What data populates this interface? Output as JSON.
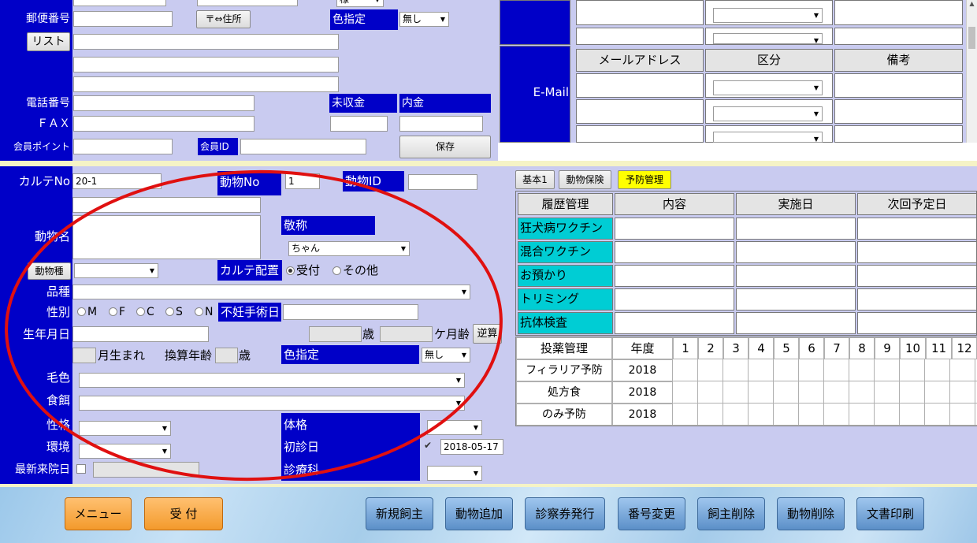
{
  "owner": {
    "postal_label": "郵便番号",
    "postal_btn": "〒⇔住所",
    "color_label": "色指定",
    "color_value": "無し",
    "list_btn": "リスト",
    "phone_label": "電話番号",
    "fax_label": "ＦＡＸ",
    "points_label": "会員ポイント",
    "member_id_label": "会員ID",
    "unpaid_label": "未収金",
    "deposit_label": "内金",
    "save_btn": "保存",
    "honorific_top": "様"
  },
  "email": {
    "label": "E-Mail",
    "headers": [
      "メールアドレス",
      "区分",
      "備考"
    ]
  },
  "animal": {
    "karte_no_label": "カルテNo",
    "karte_no_value": "20-1",
    "animal_no_label": "動物No",
    "animal_no_value": "1",
    "animal_id_label": "動物ID",
    "name_label": "動物名",
    "honorific_label": "敬称",
    "honorific_value": "ちゃん",
    "species_btn": "動物種",
    "karte_place_label": "カルテ配置",
    "radio_reception": "受付",
    "radio_other": "その他",
    "breed_label": "品種",
    "sex_label": "性別",
    "sex_options": [
      "M",
      "F",
      "C",
      "S",
      "N"
    ],
    "neuter_label": "不妊手術日",
    "birth_label": "生年月日",
    "age_unit": "歳",
    "month_unit": "ケ月齢",
    "reverse_btn": "逆算",
    "born_month": "月生まれ",
    "converted_age": "換算年齢",
    "converted_unit": "歳",
    "color_label": "色指定",
    "color_value": "無し",
    "coat_label": "毛色",
    "food_label": "食餌",
    "temper_label": "性格",
    "env_label": "環境",
    "last_visit_label": "最新来院日",
    "build_label": "体格",
    "first_visit_label": "初診日",
    "first_visit_value": "2018-05-17",
    "dept_label": "診療科"
  },
  "tabs": [
    "基本1",
    "動物保険",
    "予防管理"
  ],
  "prevention": {
    "headers": [
      "履歴管理",
      "内容",
      "実施日",
      "次回予定日"
    ],
    "rows": [
      "狂犬病ワクチン",
      "混合ワクチン",
      "お預かり",
      "トリミング",
      "抗体検査"
    ]
  },
  "medication": {
    "headers": [
      "投薬管理",
      "年度",
      "1",
      "2",
      "3",
      "4",
      "5",
      "6",
      "7",
      "8",
      "9",
      "10",
      "11",
      "12"
    ],
    "rows": [
      {
        "name": "フィラリア予防",
        "year": "2018"
      },
      {
        "name": "処方食",
        "year": "2018"
      },
      {
        "name": "のみ予防",
        "year": "2018"
      }
    ]
  },
  "footer": {
    "menu": "メニュー",
    "reception": "受 付",
    "buttons": [
      "新規飼主",
      "動物追加",
      "診察券発行",
      "番号変更",
      "飼主削除",
      "動物削除",
      "文書印刷"
    ]
  },
  "colors": {
    "panel": "#c9cbf0",
    "blue": "#0000c8",
    "cyan": "#00cdd4",
    "orange": "#f39a2c",
    "annotation": "#e01010"
  }
}
